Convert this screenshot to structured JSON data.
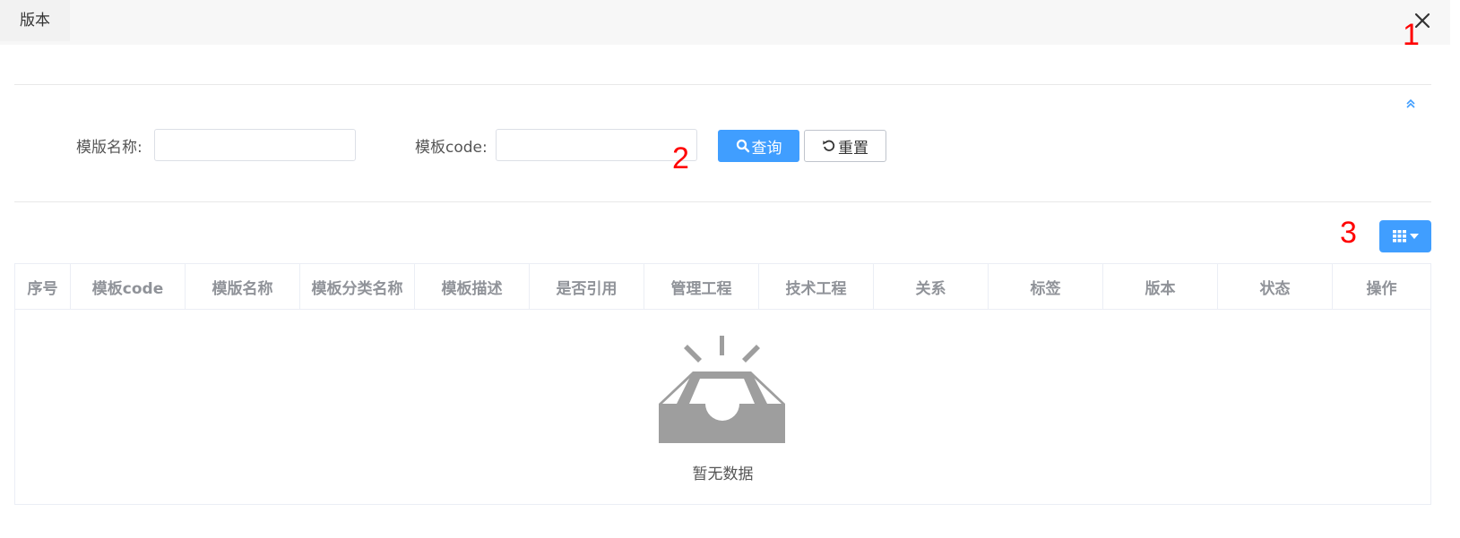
{
  "window": {
    "title": "版本"
  },
  "markers": {
    "m1": "1",
    "m2": "2",
    "m3": "3"
  },
  "search": {
    "name_label": "模版名称:",
    "name_value": "",
    "code_label": "模板code:",
    "code_value": "",
    "query_label": "查询",
    "reset_label": "重置"
  },
  "table": {
    "columns": [
      "序号",
      "模板code",
      "模版名称",
      "模板分类名称",
      "模板描述",
      "是否引用",
      "管理工程",
      "技术工程",
      "关系",
      "标签",
      "版本",
      "状态",
      "操作"
    ],
    "empty_text": "暂无数据"
  },
  "colors": {
    "primary": "#409eff",
    "marker": "#ff0000",
    "header_text": "#909399"
  },
  "icons": {
    "close": "close-icon",
    "collapse": "double-chevron-up-icon",
    "search": "search-icon",
    "reset": "refresh-icon",
    "columns": "grid-icon",
    "empty": "inbox-icon"
  }
}
